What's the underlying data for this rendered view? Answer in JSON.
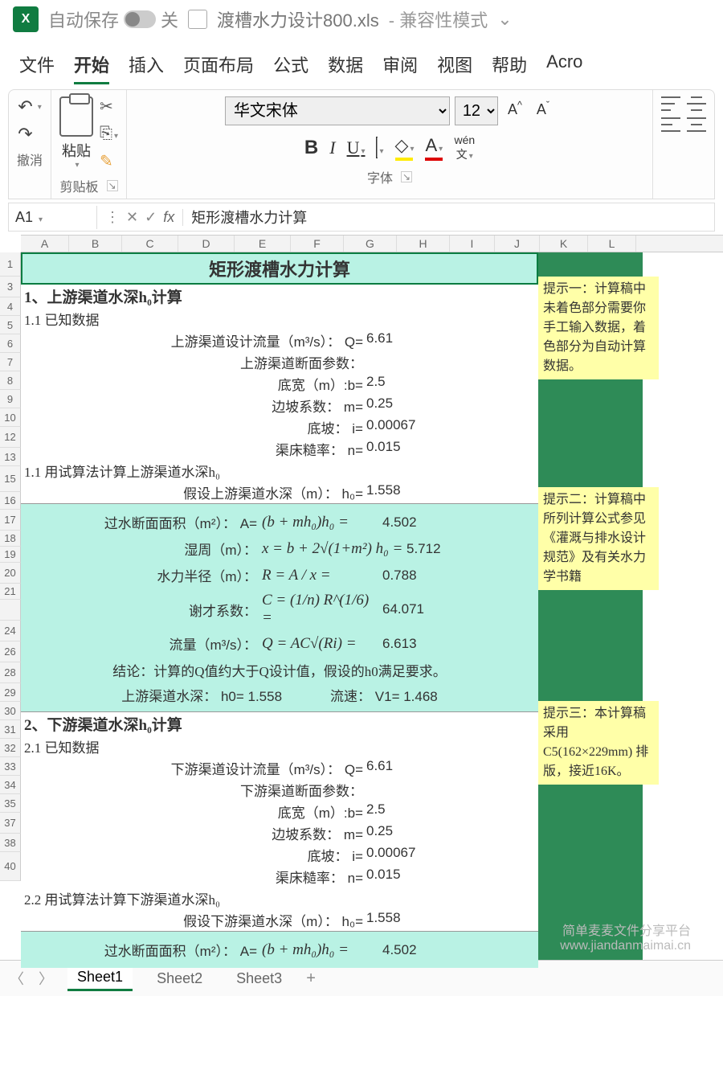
{
  "titlebar": {
    "autosave_label": "自动保存",
    "autosave_state": "关",
    "filename": "渡槽水力设计800.xls",
    "mode": "- 兼容性模式"
  },
  "ribbon_tabs": [
    "文件",
    "开始",
    "插入",
    "页面布局",
    "公式",
    "数据",
    "审阅",
    "视图",
    "帮助",
    "Acro"
  ],
  "active_tab": "开始",
  "ribbon": {
    "undo_label": "撤消",
    "clipboard_label": "剪贴板",
    "paste_label": "粘贴",
    "font_label": "字体",
    "font_name": "华文宋体",
    "font_size": "12",
    "wen_label": "wén",
    "wen_char": "文"
  },
  "namebox": "A1",
  "formula": "矩形渡槽水力计算",
  "columns": [
    "A",
    "B",
    "C",
    "D",
    "E",
    "F",
    "G",
    "H",
    "I",
    "J",
    "K",
    "L"
  ],
  "row_numbers": [
    "1",
    "3",
    "4",
    "5",
    "6",
    "7",
    "8",
    "9",
    "10",
    "12",
    "13",
    "15",
    "16",
    "17",
    "18",
    "19",
    "20",
    "21",
    "",
    "24",
    "26",
    "28",
    "29",
    "30",
    "31",
    "32",
    "33",
    "34",
    "35",
    "37",
    "38",
    "40"
  ],
  "sheet": {
    "title": "矩形渡槽水力计算",
    "sec1": "1、上游渠道水深h₀计算",
    "sec1_1": "1.1 已知数据",
    "p_flow_up": "上游渠道设计流量（m³/s）： Q=",
    "v_flow_up": "6.61",
    "p_section_up": "上游渠道断面参数：",
    "p_b": "底宽（m）:b=",
    "v_b": "2.5",
    "p_m": "边坡系数： m=",
    "v_m": "0.25",
    "p_i": "底坡： i=",
    "v_i": "0.00067",
    "p_n": "渠床糙率： n=",
    "v_n": "0.015",
    "sec1_2": "1.1 用试算法计算上游渠道水深h₀",
    "p_h0": "假设上游渠道水深（m）： h₀=",
    "v_h0": "1.558",
    "f_area_label": "过水断面面积（m²）： A=",
    "f_area_math": "(b + mh₀)h₀ =",
    "f_area_val": "4.502",
    "f_perim_label": "湿周（m）：",
    "f_perim_math": "x = b + 2√(1+m²) h₀ =",
    "f_perim_val": "5.712",
    "f_radius_label": "水力半径（m）：",
    "f_radius_math": "R = A / x =",
    "f_radius_val": "0.788",
    "f_chezy_label": "谢才系数：",
    "f_chezy_math": "C = (1/n) R^(1/6) =",
    "f_chezy_val": "64.071",
    "f_q_label": "流量（m³/s）：",
    "f_q_math": "Q = AC√(Ri) =",
    "f_q_val": "6.613",
    "conclusion": "结论：计算的Q值约大于Q设计值，假设的h0满足要求。",
    "result_h0": "上游渠道水深： h0= 1.558",
    "result_v1": "流速： V1= 1.468",
    "sec2": "2、下游渠道水深h₀计算",
    "sec2_1": "2.1 已知数据",
    "p_flow_dn": "下游渠道设计流量（m³/s）： Q=",
    "v_flow_dn": "6.61",
    "p_section_dn": "下游渠道断面参数：",
    "v_b2": "2.5",
    "v_m2": "0.25",
    "v_i2": "0.00067",
    "v_n2": "0.015",
    "sec2_2": "2.2 用试算法计算下游渠道水深h₀",
    "p_h0_dn": "假设下游渠道水深（m）： h₀=",
    "v_h0_dn": "1.558",
    "f_area_val2": "4.502"
  },
  "tips": {
    "tip1": "提示一：计算稿中未着色部分需要你手工输入数据，着色部分为自动计算数据。",
    "tip2": "提示二：计算稿中所列计算公式参见《灌溉与排水设计规范》及有关水力学书籍",
    "tip3": "提示三：本计算稿采用 C5(162×229mm) 排版，接近16K。"
  },
  "sheet_tabs": [
    "Sheet1",
    "Sheet2",
    "Sheet3"
  ],
  "active_sheet": "Sheet1",
  "watermark": {
    "line1": "简单麦麦文件分享平台",
    "line2": "www.jiandanmaimai.cn"
  }
}
